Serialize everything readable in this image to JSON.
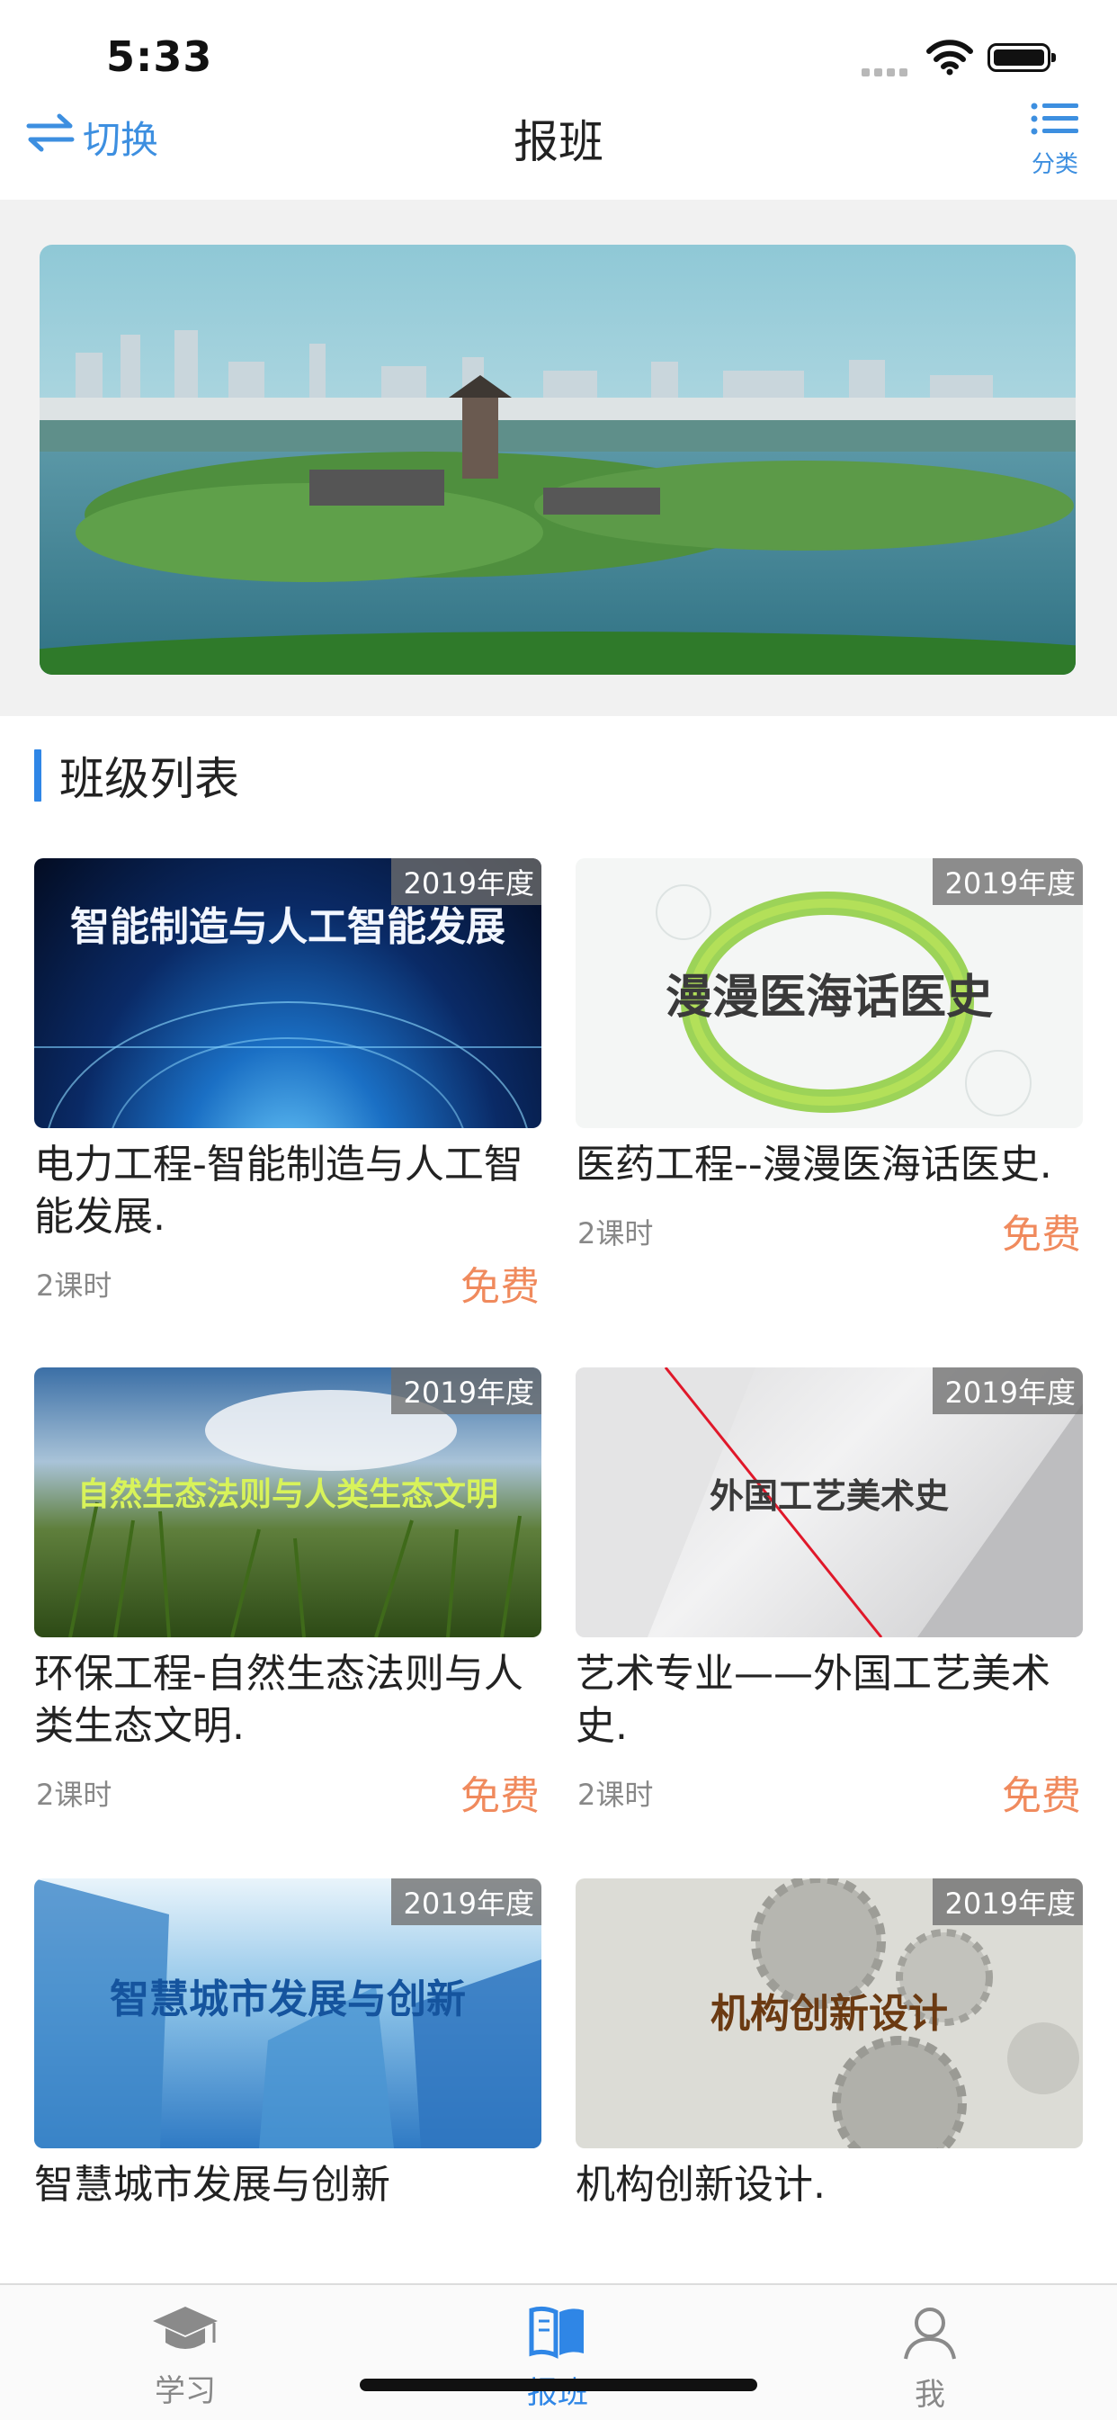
{
  "status": {
    "time": "5:33"
  },
  "nav": {
    "switch_label": "切换",
    "title": "报班",
    "category_label": "分类"
  },
  "section": {
    "title": "班级列表"
  },
  "cards": [
    {
      "year": "2019年度",
      "thumb_text": "智能制造与人工智能发展",
      "title": "电力工程-智能制造与人工智能发展.",
      "hours": "2课时",
      "price": "免费"
    },
    {
      "year": "2019年度",
      "thumb_text": "漫漫医海话医史",
      "title": "医药工程--漫漫医海话医史.",
      "hours": "2课时",
      "price": "免费"
    },
    {
      "year": "2019年度",
      "thumb_text": "自然生态法则与人类生态文明",
      "title": "环保工程-自然生态法则与人类生态文明.",
      "hours": "2课时",
      "price": "免费"
    },
    {
      "year": "2019年度",
      "thumb_text": "外国工艺美术史",
      "title": "艺术专业——外国工艺美术史.",
      "hours": "2课时",
      "price": "免费"
    },
    {
      "year": "2019年度",
      "thumb_text": "智慧城市发展与创新",
      "title": "智慧城市发展与创新"
    },
    {
      "year": "2019年度",
      "thumb_text": "机构创新设计",
      "title": "机构创新设计."
    }
  ],
  "tabs": [
    {
      "label": "学习",
      "icon": "graduation-cap-icon"
    },
    {
      "label": "报班",
      "icon": "book-icon",
      "active": true
    },
    {
      "label": "我",
      "icon": "user-icon"
    }
  ],
  "colors": {
    "accent": "#2f86e6",
    "price": "#f08a5d",
    "link": "#3d8fe0"
  }
}
